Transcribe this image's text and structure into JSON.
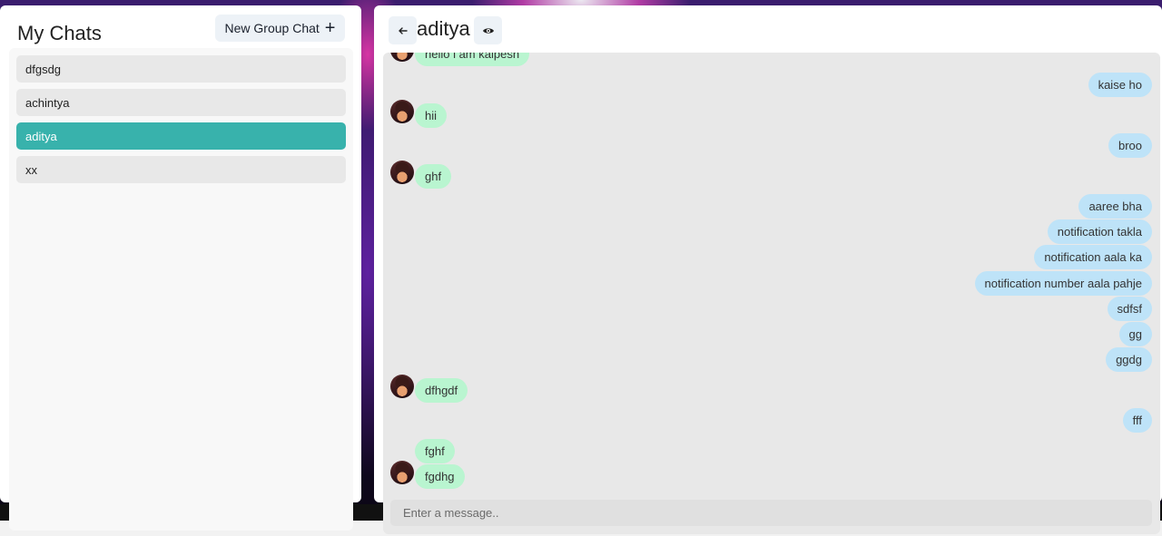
{
  "sidebar": {
    "title": "My Chats",
    "new_group_label": "New Group Chat",
    "chats": [
      {
        "name": "dfgsdg",
        "active": false
      },
      {
        "name": "achintya",
        "active": false
      },
      {
        "name": "aditya",
        "active": true
      },
      {
        "name": "xx",
        "active": false
      }
    ]
  },
  "chat": {
    "title": "aditya",
    "messages": [
      {
        "text": "hello i am kalpesh",
        "from": "received",
        "avatar": true
      },
      {
        "text": "kaise ho",
        "from": "sent",
        "avatar": false
      },
      {
        "text": "hii",
        "from": "received",
        "avatar": true
      },
      {
        "text": "broo",
        "from": "sent",
        "avatar": false
      },
      {
        "text": "ghf",
        "from": "received",
        "avatar": true
      },
      {
        "text": "aaree bha",
        "from": "sent",
        "avatar": false
      },
      {
        "text": "notification takla",
        "from": "sent",
        "avatar": false
      },
      {
        "text": "notification aala ka",
        "from": "sent",
        "avatar": false
      },
      {
        "text": "notification number aala pahje",
        "from": "sent",
        "avatar": false
      },
      {
        "text": "sdfsf",
        "from": "sent",
        "avatar": false
      },
      {
        "text": "gg",
        "from": "sent",
        "avatar": false
      },
      {
        "text": "ggdg",
        "from": "sent",
        "avatar": false
      },
      {
        "text": "dfhgdf",
        "from": "received",
        "avatar": true
      },
      {
        "text": "fff",
        "from": "sent",
        "avatar": false
      },
      {
        "text": "fghf",
        "from": "received",
        "avatar": false
      },
      {
        "text": "fgdhg",
        "from": "received",
        "avatar": true
      }
    ],
    "input_placeholder": "Enter a message.."
  },
  "colors": {
    "accent": "#38b2ac",
    "received_bubble": "#b9f5d0",
    "sent_bubble": "#bee3f8"
  }
}
